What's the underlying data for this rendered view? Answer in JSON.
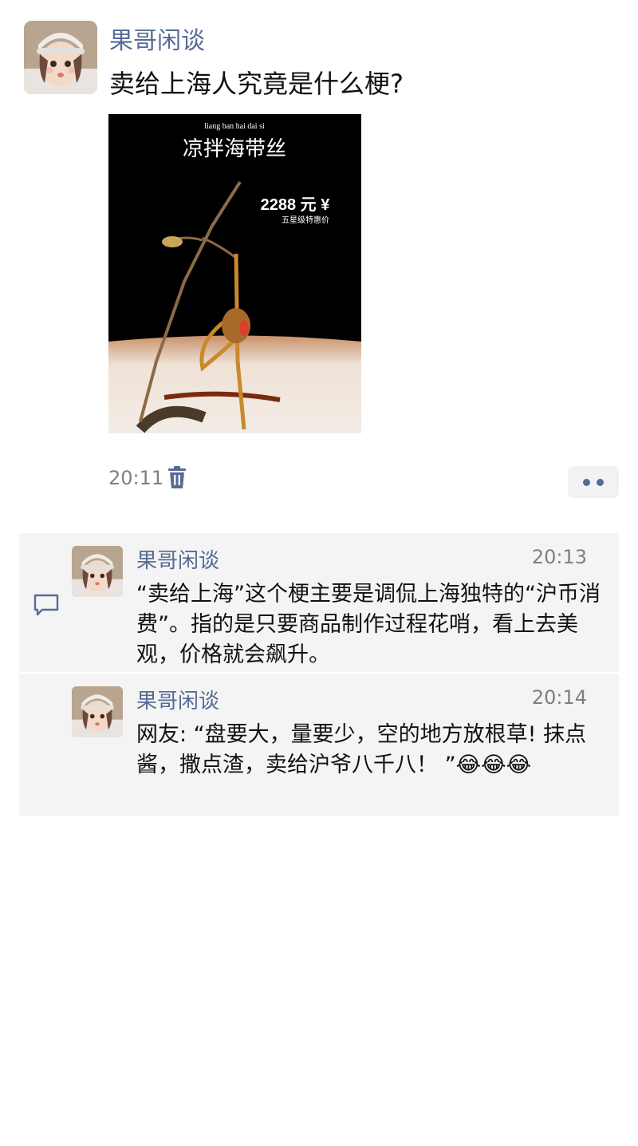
{
  "post": {
    "author": "果哥闲谈",
    "text": "卖给上海人究竟是什么梗?",
    "time": "20:11",
    "image": {
      "pinyin": "liang   ban   hai   dai   si",
      "title": "凉拌海带丝",
      "price": "2288 元 ¥",
      "price_note": "五星级特惠价"
    }
  },
  "comments": [
    {
      "author": "果哥闲谈",
      "time": "20:13",
      "text": "“卖给上海”这个梗主要是调侃上海独特的“沪币消费”。指的是只要商品制作过程花哨，看上去美观，价格就会飙升。"
    },
    {
      "author": "果哥闲谈",
      "time": "20:14",
      "text": "网友: “盘要大，量要少，空的地方放根草! 抹点酱，撒点渣，卖给沪爷八千八！ ”😂😂😂"
    }
  ],
  "icons": {
    "delete": "trash-icon",
    "more": "more-dots-icon",
    "comment": "comment-bubble-icon"
  },
  "colors": {
    "link": "#576b95",
    "comment_bg": "#f4f4f4"
  }
}
